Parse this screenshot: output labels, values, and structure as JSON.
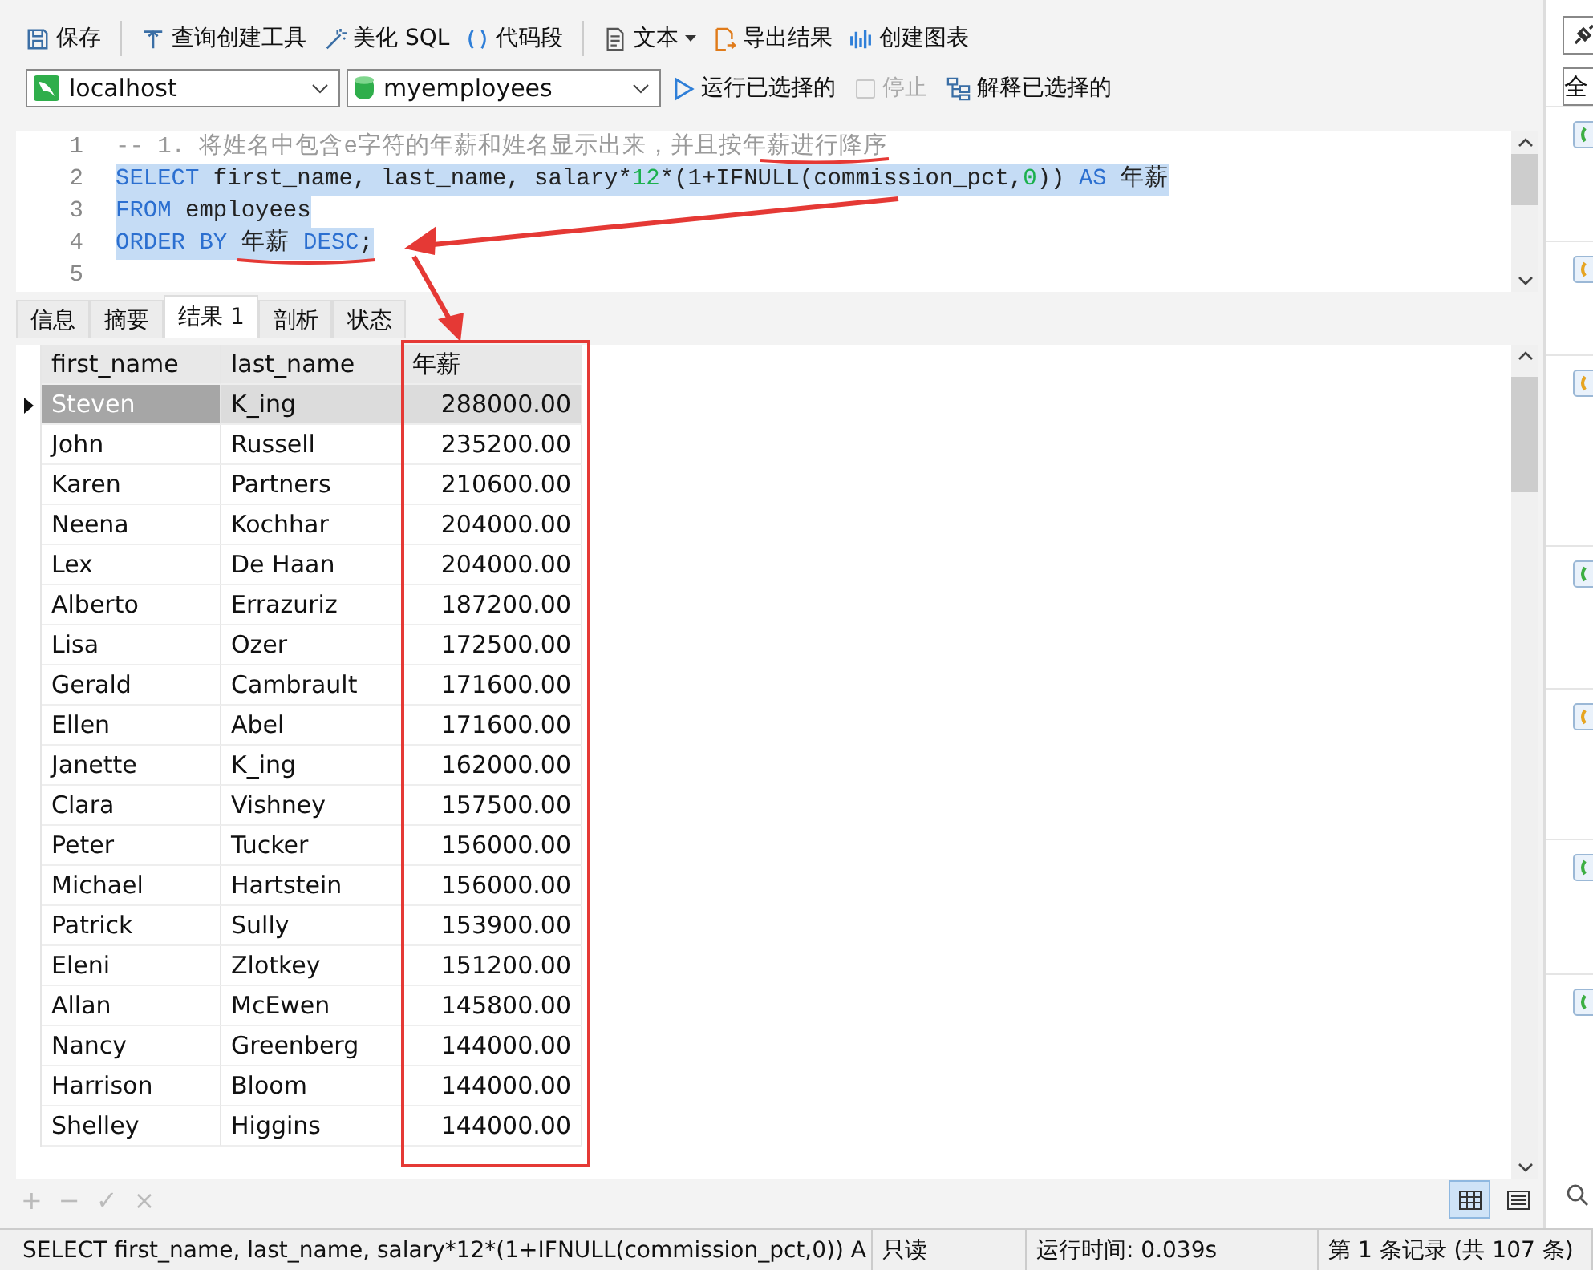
{
  "toolbar": {
    "buttons": [
      {
        "label": "保存"
      },
      {
        "label": "查询创建工具"
      },
      {
        "label": "美化 SQL"
      },
      {
        "label": "代码段"
      },
      {
        "label": "文本"
      },
      {
        "label": "导出结果"
      },
      {
        "label": "创建图表"
      }
    ]
  },
  "connection": {
    "server": "localhost",
    "database": "myemployees",
    "actions": [
      {
        "label": "运行已选择的",
        "disabled": false
      },
      {
        "label": "停止",
        "disabled": true
      },
      {
        "label": "解释已选择的",
        "disabled": false
      }
    ]
  },
  "editor": {
    "lines": [
      {
        "number": "1",
        "selected": false,
        "tokens": [
          {
            "kind": "comment",
            "text": "-- 1. 将姓名中包含e字符的年薪和姓名显示出来，并且按年薪进行降序"
          }
        ]
      },
      {
        "number": "2",
        "selected": true,
        "tokens": [
          {
            "kind": "keyword",
            "text": "SELECT"
          },
          {
            "kind": "plain",
            "text": " first_name, last_name, salary*"
          },
          {
            "kind": "number",
            "text": "12"
          },
          {
            "kind": "plain",
            "text": "*(1+IFNULL(commission_pct,"
          },
          {
            "kind": "number",
            "text": "0"
          },
          {
            "kind": "plain",
            "text": ")) "
          },
          {
            "kind": "keyword",
            "text": "AS"
          },
          {
            "kind": "plain",
            "text": " 年薪"
          }
        ]
      },
      {
        "number": "3",
        "selected": true,
        "tokens": [
          {
            "kind": "keyword",
            "text": "FROM"
          },
          {
            "kind": "plain",
            "text": " employees"
          }
        ]
      },
      {
        "number": "4",
        "selected": true,
        "tokens": [
          {
            "kind": "keyword",
            "text": "ORDER BY"
          },
          {
            "kind": "plain",
            "text": " 年薪 "
          },
          {
            "kind": "keyword",
            "text": "DESC"
          },
          {
            "kind": "plain",
            "text": ";"
          }
        ]
      },
      {
        "number": "5"
      }
    ]
  },
  "tabs": [
    {
      "label": "信息",
      "selected": false
    },
    {
      "label": "摘要",
      "selected": false
    },
    {
      "label": "结果 1",
      "selected": true
    },
    {
      "label": "剖析",
      "selected": false
    },
    {
      "label": "状态",
      "selected": false
    }
  ],
  "table": {
    "columns": [
      "first_name",
      "last_name",
      "年薪"
    ],
    "rows": [
      {
        "selected": true,
        "cells": [
          "Steven",
          "K_ing",
          "288000.00"
        ]
      },
      {
        "selected": false,
        "cells": [
          "John",
          "Russell",
          "235200.00"
        ]
      },
      {
        "selected": false,
        "cells": [
          "Karen",
          "Partners",
          "210600.00"
        ]
      },
      {
        "selected": false,
        "cells": [
          "Neena",
          "Kochhar",
          "204000.00"
        ]
      },
      {
        "selected": false,
        "cells": [
          "Lex",
          "De Haan",
          "204000.00"
        ]
      },
      {
        "selected": false,
        "cells": [
          "Alberto",
          "Errazuriz",
          "187200.00"
        ]
      },
      {
        "selected": false,
        "cells": [
          "Lisa",
          "Ozer",
          "172500.00"
        ]
      },
      {
        "selected": false,
        "cells": [
          "Gerald",
          "Cambrault",
          "171600.00"
        ]
      },
      {
        "selected": false,
        "cells": [
          "Ellen",
          "Abel",
          "171600.00"
        ]
      },
      {
        "selected": false,
        "cells": [
          "Janette",
          "K_ing",
          "162000.00"
        ]
      },
      {
        "selected": false,
        "cells": [
          "Clara",
          "Vishney",
          "157500.00"
        ]
      },
      {
        "selected": false,
        "cells": [
          "Peter",
          "Tucker",
          "156000.00"
        ]
      },
      {
        "selected": false,
        "cells": [
          "Michael",
          "Hartstein",
          "156000.00"
        ]
      },
      {
        "selected": false,
        "cells": [
          "Patrick",
          "Sully",
          "153900.00"
        ]
      },
      {
        "selected": false,
        "cells": [
          "Eleni",
          "Zlotkey",
          "151200.00"
        ]
      },
      {
        "selected": false,
        "cells": [
          "Allan",
          "McEwen",
          "145800.00"
        ]
      },
      {
        "selected": false,
        "cells": [
          "Nancy",
          "Greenberg",
          "144000.00"
        ]
      },
      {
        "selected": false,
        "cells": [
          "Harrison",
          "Bloom",
          "144000.00"
        ]
      },
      {
        "selected": false,
        "cells": [
          "Shelley",
          "Higgins",
          "144000.00"
        ]
      }
    ]
  },
  "grid_actions": [
    {
      "symbol": "+"
    },
    {
      "symbol": "−"
    },
    {
      "symbol": "✓"
    },
    {
      "symbol": "×"
    }
  ],
  "view_modes": [
    {
      "selected": true
    },
    {
      "selected": false
    }
  ],
  "status_bar": {
    "query": "SELECT first_name, last_name, salary*12*(1+IFNULL(commission_pct,0)) A",
    "mode": "只读",
    "time": "运行时间: 0.039s",
    "record": "第 1 条记录 (共 107 条)"
  },
  "side_panel": {
    "filter": "全",
    "items": [
      {
        "color": "#3cb043"
      },
      {
        "color": "#e8a520"
      },
      {
        "color": "#e8a520"
      },
      {
        "color": "#3cb043"
      },
      {
        "color": "#e8a520"
      },
      {
        "color": "#3cb043"
      },
      {
        "color": "#3cb043"
      }
    ]
  }
}
